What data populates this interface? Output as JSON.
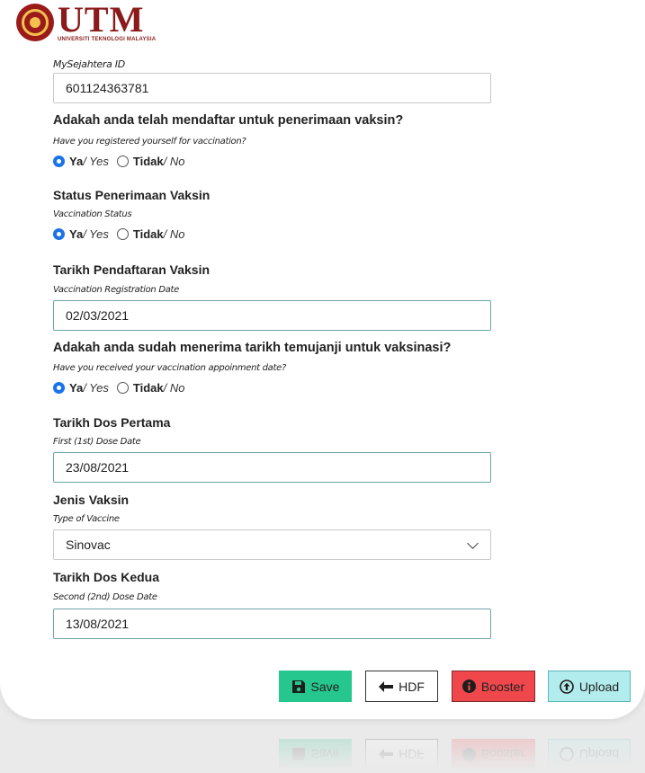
{
  "logo": {
    "title": "UTM",
    "subtitle": "UNIVERSITI TEKNOLOGI MALAYSIA"
  },
  "mysejahtera": {
    "label": "MySejahtera ID",
    "value": "601124363781"
  },
  "registered": {
    "label": "Adakah anda telah mendaftar untuk penerimaan vaksin?",
    "sub": "Have you registered yourself for vaccination?",
    "yes_bold": "Ya",
    "yes_ital": " / Yes",
    "no_bold": "Tidak",
    "no_ital": " / No",
    "selected": "yes"
  },
  "status": {
    "label": "Status Penerimaan Vaksin",
    "sub": "Vaccination Status",
    "yes_bold": "Ya",
    "yes_ital": " / Yes",
    "no_bold": "Tidak",
    "no_ital": " / No",
    "selected": "yes"
  },
  "reg_date": {
    "label": "Tarikh Pendaftaran Vaksin",
    "sub": "Vaccination Registration Date",
    "value": "02/03/2021"
  },
  "appointment": {
    "label": "Adakah anda sudah menerima tarikh temujanji untuk vaksinasi?",
    "sub": "Have you received your vaccination appoinment date?",
    "yes_bold": "Ya",
    "yes_ital": " / Yes",
    "no_bold": "Tidak",
    "no_ital": " / No",
    "selected": "yes"
  },
  "first_dose": {
    "label": "Tarikh Dos Pertama",
    "sub": "First (1st) Dose Date",
    "value": "23/08/2021"
  },
  "vaccine_type": {
    "label": "Jenis Vaksin",
    "sub": "Type of Vaccine",
    "value": "Sinovac"
  },
  "second_dose": {
    "label": "Tarikh Dos Kedua",
    "sub": "Second (2nd) Dose Date",
    "value": "13/08/2021"
  },
  "buttons": {
    "save": "Save",
    "hdf": "HDF",
    "booster": "Booster",
    "upload": "Upload"
  },
  "colors": {
    "save": "#26c68f",
    "booster": "#f0474c",
    "upload": "#b3ecec",
    "radio_checked": "#1a73e8",
    "brand": "#8b1a1a"
  },
  "icons": {
    "save": "floppy-disk-icon",
    "hdf": "arrow-left-icon",
    "booster": "info-circle-icon",
    "upload": "upload-circle-icon",
    "select": "chevron-down-icon"
  }
}
